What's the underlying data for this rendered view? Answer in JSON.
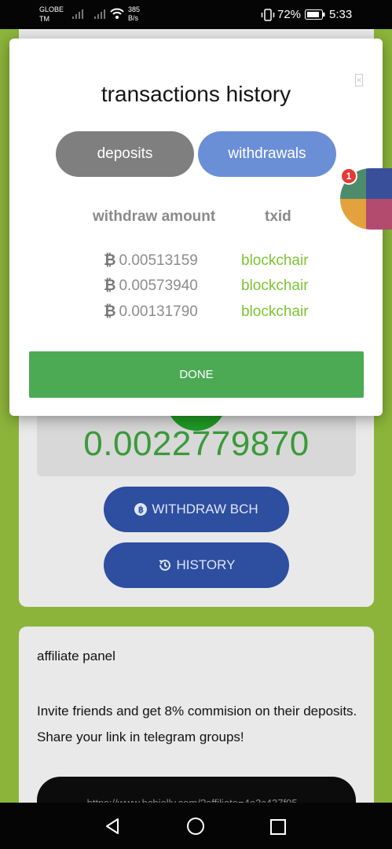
{
  "status_bar": {
    "carrier_line1": "GLOBE",
    "carrier_line2": "TM",
    "speed_value": "385",
    "speed_unit": "B/s",
    "battery_percent": "72%",
    "time": "5:33"
  },
  "background_app": {
    "balance_value": "0.0022779870",
    "withdraw_button_label": "WITHDRAW BCH",
    "history_button_label": "HISTORY",
    "affiliate": {
      "title": "affiliate panel",
      "description": "Invite friends and get 8% commision on their deposits. Share your link in telegram groups!",
      "link_partial": "https://www.bchjolly.com/?affiliate=4e3c437f95..."
    }
  },
  "modal": {
    "title": "transactions history",
    "tabs": [
      {
        "label": "deposits",
        "active": false
      },
      {
        "label": "withdrawals",
        "active": true
      }
    ],
    "columns": {
      "amount": "withdraw amount",
      "txid": "txid"
    },
    "currency_symbol": "₿",
    "rows": [
      {
        "amount": "0.00513159",
        "txid_link": "blockchair"
      },
      {
        "amount": "0.00573940",
        "txid_link": "blockchair"
      },
      {
        "amount": "0.00131790",
        "txid_link": "blockchair"
      }
    ],
    "done_label": "DONE"
  },
  "chat_head": {
    "badge_count": "1"
  },
  "colors": {
    "page_bg": "#8cb43a",
    "tab_active": "#6b8fd7",
    "tab_inactive": "#7f7f7f",
    "link_green": "#7bc531",
    "done_green": "#4caa55",
    "pill_blue": "#2e4ea0"
  },
  "icons": [
    "signal-icon",
    "wifi-icon",
    "vibrate-icon",
    "battery-icon",
    "bitcoin-icon",
    "history-icon",
    "back-icon",
    "home-icon",
    "recents-icon",
    "close-icon"
  ]
}
